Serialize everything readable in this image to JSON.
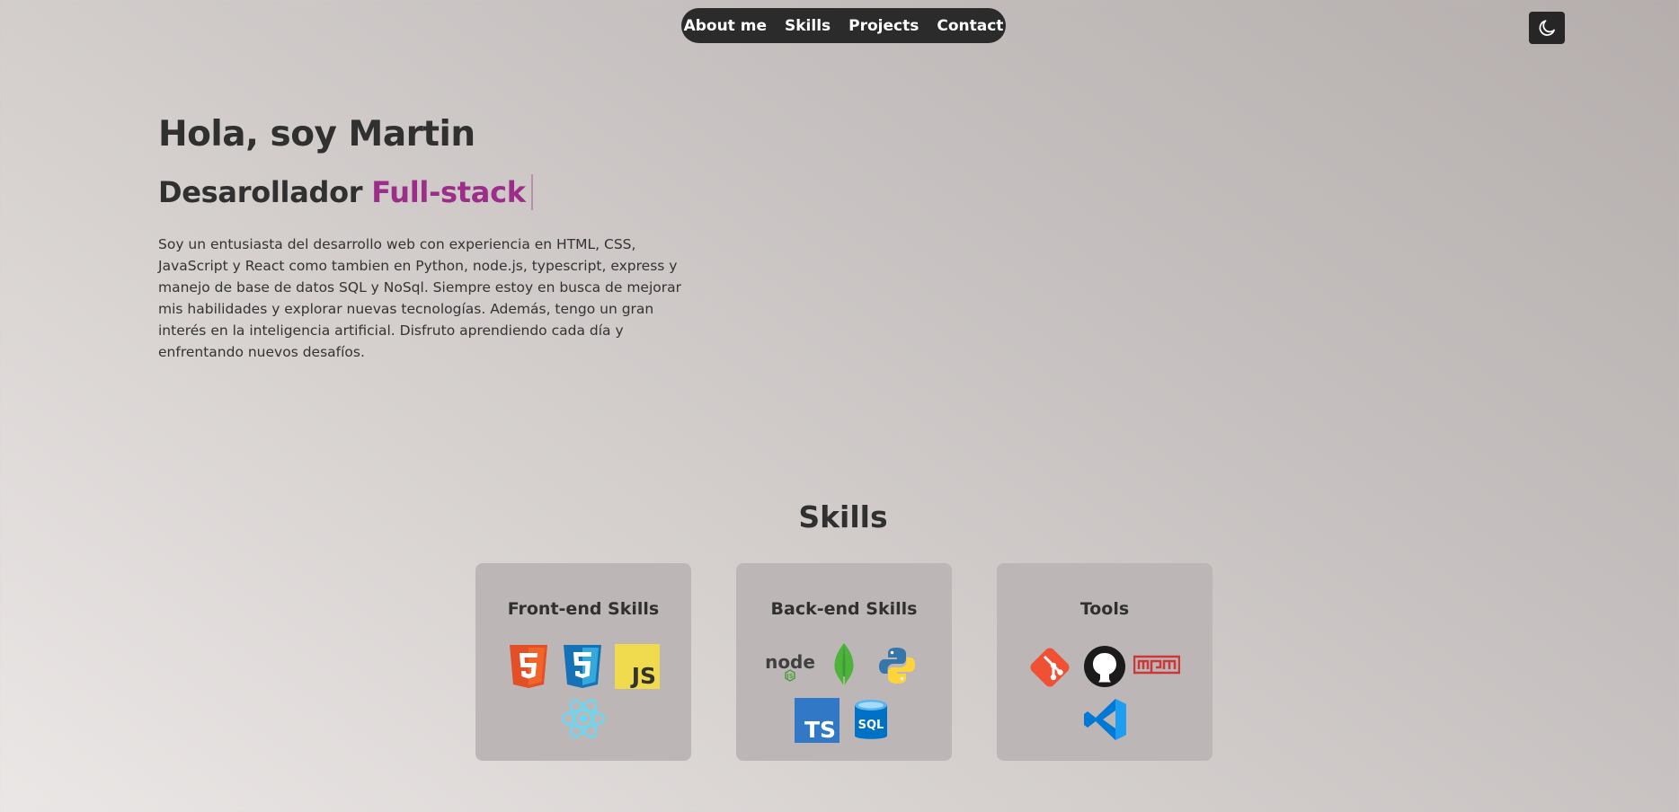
{
  "nav": {
    "items": [
      {
        "label": "About me"
      },
      {
        "label": "Skills"
      },
      {
        "label": "Projects"
      },
      {
        "label": "Contact"
      }
    ]
  },
  "theme_toggle": {
    "icon": "moon-icon"
  },
  "hero": {
    "title": "Hola, soy Martin",
    "role_prefix": "Desarollador",
    "role_highlight": "Full-stack",
    "description": "Soy un entusiasta del desarrollo web con experiencia en HTML, CSS, JavaScript y React como tambien en Python, node.js, typescript, express y manejo de base de datos SQL y NoSql. Siempre estoy en busca de mejorar mis habilidades y explorar nuevas tecnologías. Además, tengo un gran interés en la inteligencia artificial. Disfruto aprendiendo cada día y enfrentando nuevos desafíos."
  },
  "skills": {
    "title": "Skills",
    "cards": [
      {
        "title": "Front-end Skills",
        "icons": [
          "html5-icon",
          "css3-icon",
          "javascript-icon",
          "react-icon"
        ]
      },
      {
        "title": "Back-end Skills",
        "icons": [
          "nodejs-icon",
          "mongodb-icon",
          "python-icon",
          "typescript-icon",
          "sql-database-icon"
        ]
      },
      {
        "title": "Tools",
        "icons": [
          "git-icon",
          "github-icon",
          "npm-icon",
          "vscode-icon"
        ]
      }
    ]
  },
  "colors": {
    "accent": "#9c2d88",
    "text": "#303030",
    "nav_bg": "#2b2b2b",
    "card_bg": "#bcb7b6"
  }
}
